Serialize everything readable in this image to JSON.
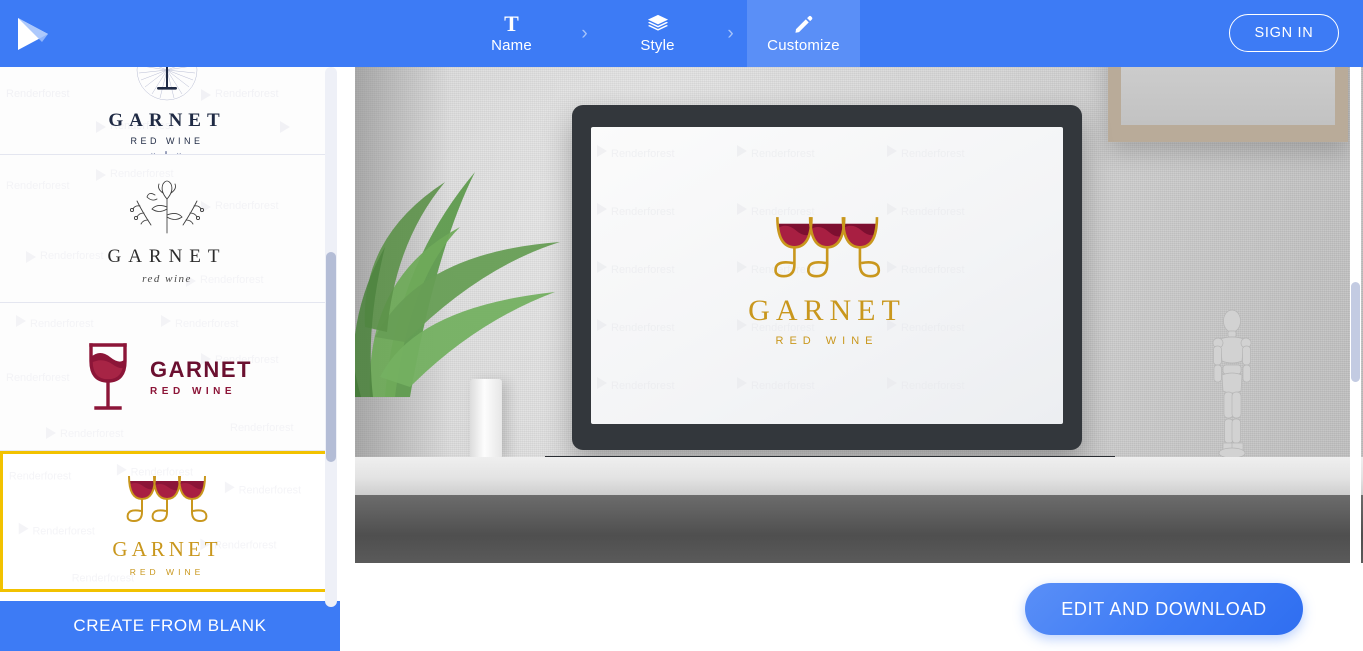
{
  "header": {
    "brand_icon": "renderforest-play-logo",
    "accent_color": "#3d7bf5",
    "active_tab_color": "#5a8ff7",
    "steps": [
      {
        "label": "Name",
        "icon": "text-t-icon",
        "active": false
      },
      {
        "label": "Style",
        "icon": "layers-icon",
        "active": false
      },
      {
        "label": "Customize",
        "icon": "pencil-icon",
        "active": true
      }
    ],
    "separator_glyph": "›",
    "sign_in_label": "SIGN IN"
  },
  "sidebar": {
    "selected_border_color": "#f2c200",
    "watermark_text": "Renderforest",
    "create_from_blank_label": "CREATE FROM BLANK",
    "items": [
      {
        "id": "logo-sunburst-glass",
        "variant": "sunburst",
        "name": "GARNET",
        "sub": "RED WINE",
        "ornament": "×  ❙  ×",
        "color": "#1f2a44",
        "selected": false
      },
      {
        "id": "logo-floral-sketch",
        "variant": "floral",
        "name": "GARNET",
        "sub": "red wine",
        "color": "#2b2b2b",
        "selected": false
      },
      {
        "id": "logo-glass-horizontal",
        "variant": "glass-left",
        "name": "GARNET",
        "sub": "RED WINE",
        "color": "#8c1538",
        "selected": false
      },
      {
        "id": "logo-three-glasses",
        "variant": "three-glasses",
        "name": "GARNET",
        "sub": "RED WINE",
        "color": "#c9971d",
        "selected": true
      }
    ],
    "scrollbar": {
      "thumb_color": "#b4bdd6",
      "track_color": "#eef0f7"
    }
  },
  "main": {
    "preview_alt": "laptop-mockup-on-shelf-with-plant-mannequin-and-picture-frame",
    "screen_logo": {
      "name": "GARNET",
      "sub": "RED WINE",
      "gold": "#c9971d",
      "wine": "#8c1538"
    },
    "edit_download_label": "EDIT AND DOWNLOAD",
    "watermark_text": "Renderforest",
    "scrollbar": {
      "thumb_color": "#c3cbe2"
    }
  }
}
